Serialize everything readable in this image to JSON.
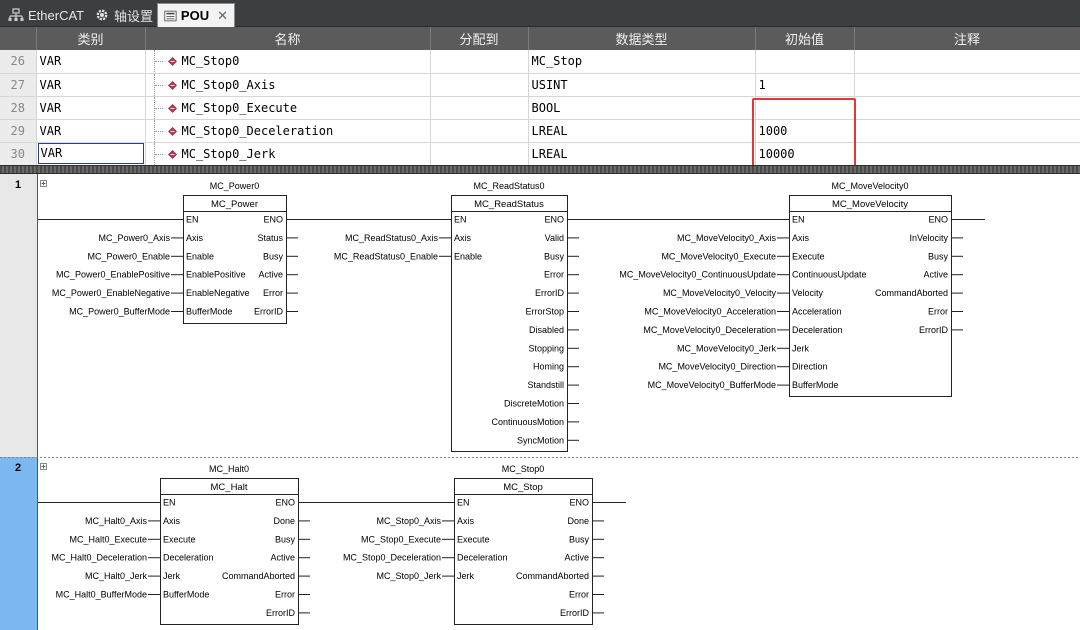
{
  "tabs": [
    {
      "label": "EtherCAT",
      "icon": "network-icon"
    },
    {
      "label": "轴设置",
      "icon": "gear-icon"
    },
    {
      "label": "POU",
      "icon": "pou-icon",
      "active": true
    }
  ],
  "variables": {
    "headers": [
      "类别",
      "名称",
      "分配到",
      "数据类型",
      "初始值",
      "注释"
    ],
    "rows": [
      {
        "num": "26",
        "category": "VAR",
        "name": "MC_Stop0",
        "assign": "",
        "type": "MC_Stop",
        "init": "",
        "comment": ""
      },
      {
        "num": "27",
        "category": "VAR",
        "name": "MC_Stop0_Axis",
        "assign": "",
        "type": "USINT",
        "init": "1",
        "comment": ""
      },
      {
        "num": "28",
        "category": "VAR",
        "name": "MC_Stop0_Execute",
        "assign": "",
        "type": "BOOL",
        "init": "",
        "comment": ""
      },
      {
        "num": "29",
        "category": "VAR",
        "name": "MC_Stop0_Deceleration",
        "assign": "",
        "type": "LREAL",
        "init": "1000",
        "comment": ""
      },
      {
        "num": "30",
        "category": "VAR",
        "name": "MC_Stop0_Jerk",
        "assign": "",
        "type": "LREAL",
        "init": "10000",
        "comment": ""
      }
    ]
  },
  "rungs": [
    {
      "number": "1",
      "blocks": [
        {
          "instance": "MC_Power0",
          "type": "MC_Power",
          "inputs": [
            {
              "pin": "EN",
              "var": ""
            },
            {
              "pin": "Axis",
              "var": "MC_Power0_Axis"
            },
            {
              "pin": "Enable",
              "var": "MC_Power0_Enable"
            },
            {
              "pin": "EnablePositive",
              "var": "MC_Power0_EnablePositive"
            },
            {
              "pin": "EnableNegative",
              "var": "MC_Power0_EnableNegative"
            },
            {
              "pin": "BufferMode",
              "var": "MC_Power0_BufferMode"
            }
          ],
          "outputs": [
            "ENO",
            "Status",
            "Busy",
            "Active",
            "Error",
            "ErrorID"
          ]
        },
        {
          "instance": "MC_ReadStatus0",
          "type": "MC_ReadStatus",
          "inputs": [
            {
              "pin": "EN",
              "var": ""
            },
            {
              "pin": "Axis",
              "var": "MC_ReadStatus0_Axis"
            },
            {
              "pin": "Enable",
              "var": "MC_ReadStatus0_Enable"
            }
          ],
          "outputs": [
            "ENO",
            "Valid",
            "Busy",
            "Error",
            "ErrorID",
            "ErrorStop",
            "Disabled",
            "Stopping",
            "Homing",
            "Standstill",
            "DiscreteMotion",
            "ContinuousMotion",
            "SyncMotion"
          ]
        },
        {
          "instance": "MC_MoveVelocity0",
          "type": "MC_MoveVelocity",
          "inputs": [
            {
              "pin": "EN",
              "var": ""
            },
            {
              "pin": "Axis",
              "var": "MC_MoveVelocity0_Axis"
            },
            {
              "pin": "Execute",
              "var": "MC_MoveVelocity0_Execute"
            },
            {
              "pin": "ContinuousUpdate",
              "var": "MC_MoveVelocity0_ContinuousUpdate"
            },
            {
              "pin": "Velocity",
              "var": "MC_MoveVelocity0_Velocity"
            },
            {
              "pin": "Acceleration",
              "var": "MC_MoveVelocity0_Acceleration"
            },
            {
              "pin": "Deceleration",
              "var": "MC_MoveVelocity0_Deceleration"
            },
            {
              "pin": "Jerk",
              "var": "MC_MoveVelocity0_Jerk"
            },
            {
              "pin": "Direction",
              "var": "MC_MoveVelocity0_Direction"
            },
            {
              "pin": "BufferMode",
              "var": "MC_MoveVelocity0_BufferMode"
            }
          ],
          "outputs": [
            "ENO",
            "InVelocity",
            "Busy",
            "Active",
            "CommandAborted",
            "Error",
            "ErrorID"
          ]
        }
      ]
    },
    {
      "number": "2",
      "blocks": [
        {
          "instance": "MC_Halt0",
          "type": "MC_Halt",
          "inputs": [
            {
              "pin": "EN",
              "var": ""
            },
            {
              "pin": "Axis",
              "var": "MC_Halt0_Axis"
            },
            {
              "pin": "Execute",
              "var": "MC_Halt0_Execute"
            },
            {
              "pin": "Deceleration",
              "var": "MC_Halt0_Deceleration"
            },
            {
              "pin": "Jerk",
              "var": "MC_Halt0_Jerk"
            },
            {
              "pin": "BufferMode",
              "var": "MC_Halt0_BufferMode"
            }
          ],
          "outputs": [
            "ENO",
            "Done",
            "Busy",
            "Active",
            "CommandAborted",
            "Error",
            "ErrorID"
          ]
        },
        {
          "instance": "MC_Stop0",
          "type": "MC_Stop",
          "inputs": [
            {
              "pin": "EN",
              "var": ""
            },
            {
              "pin": "Axis",
              "var": "MC_Stop0_Axis"
            },
            {
              "pin": "Execute",
              "var": "MC_Stop0_Execute"
            },
            {
              "pin": "Deceleration",
              "var": "MC_Stop0_Deceleration"
            },
            {
              "pin": "Jerk",
              "var": "MC_Stop0_Jerk"
            }
          ],
          "outputs": [
            "ENO",
            "Done",
            "Busy",
            "Active",
            "CommandAborted",
            "Error",
            "ErrorID"
          ]
        }
      ]
    }
  ],
  "colors": {
    "highlight_box": "#e0383a",
    "rung_selected": "#7cb7ef",
    "header_bg": "#5b5b5b",
    "tabbar_bg": "#3c3f41"
  }
}
